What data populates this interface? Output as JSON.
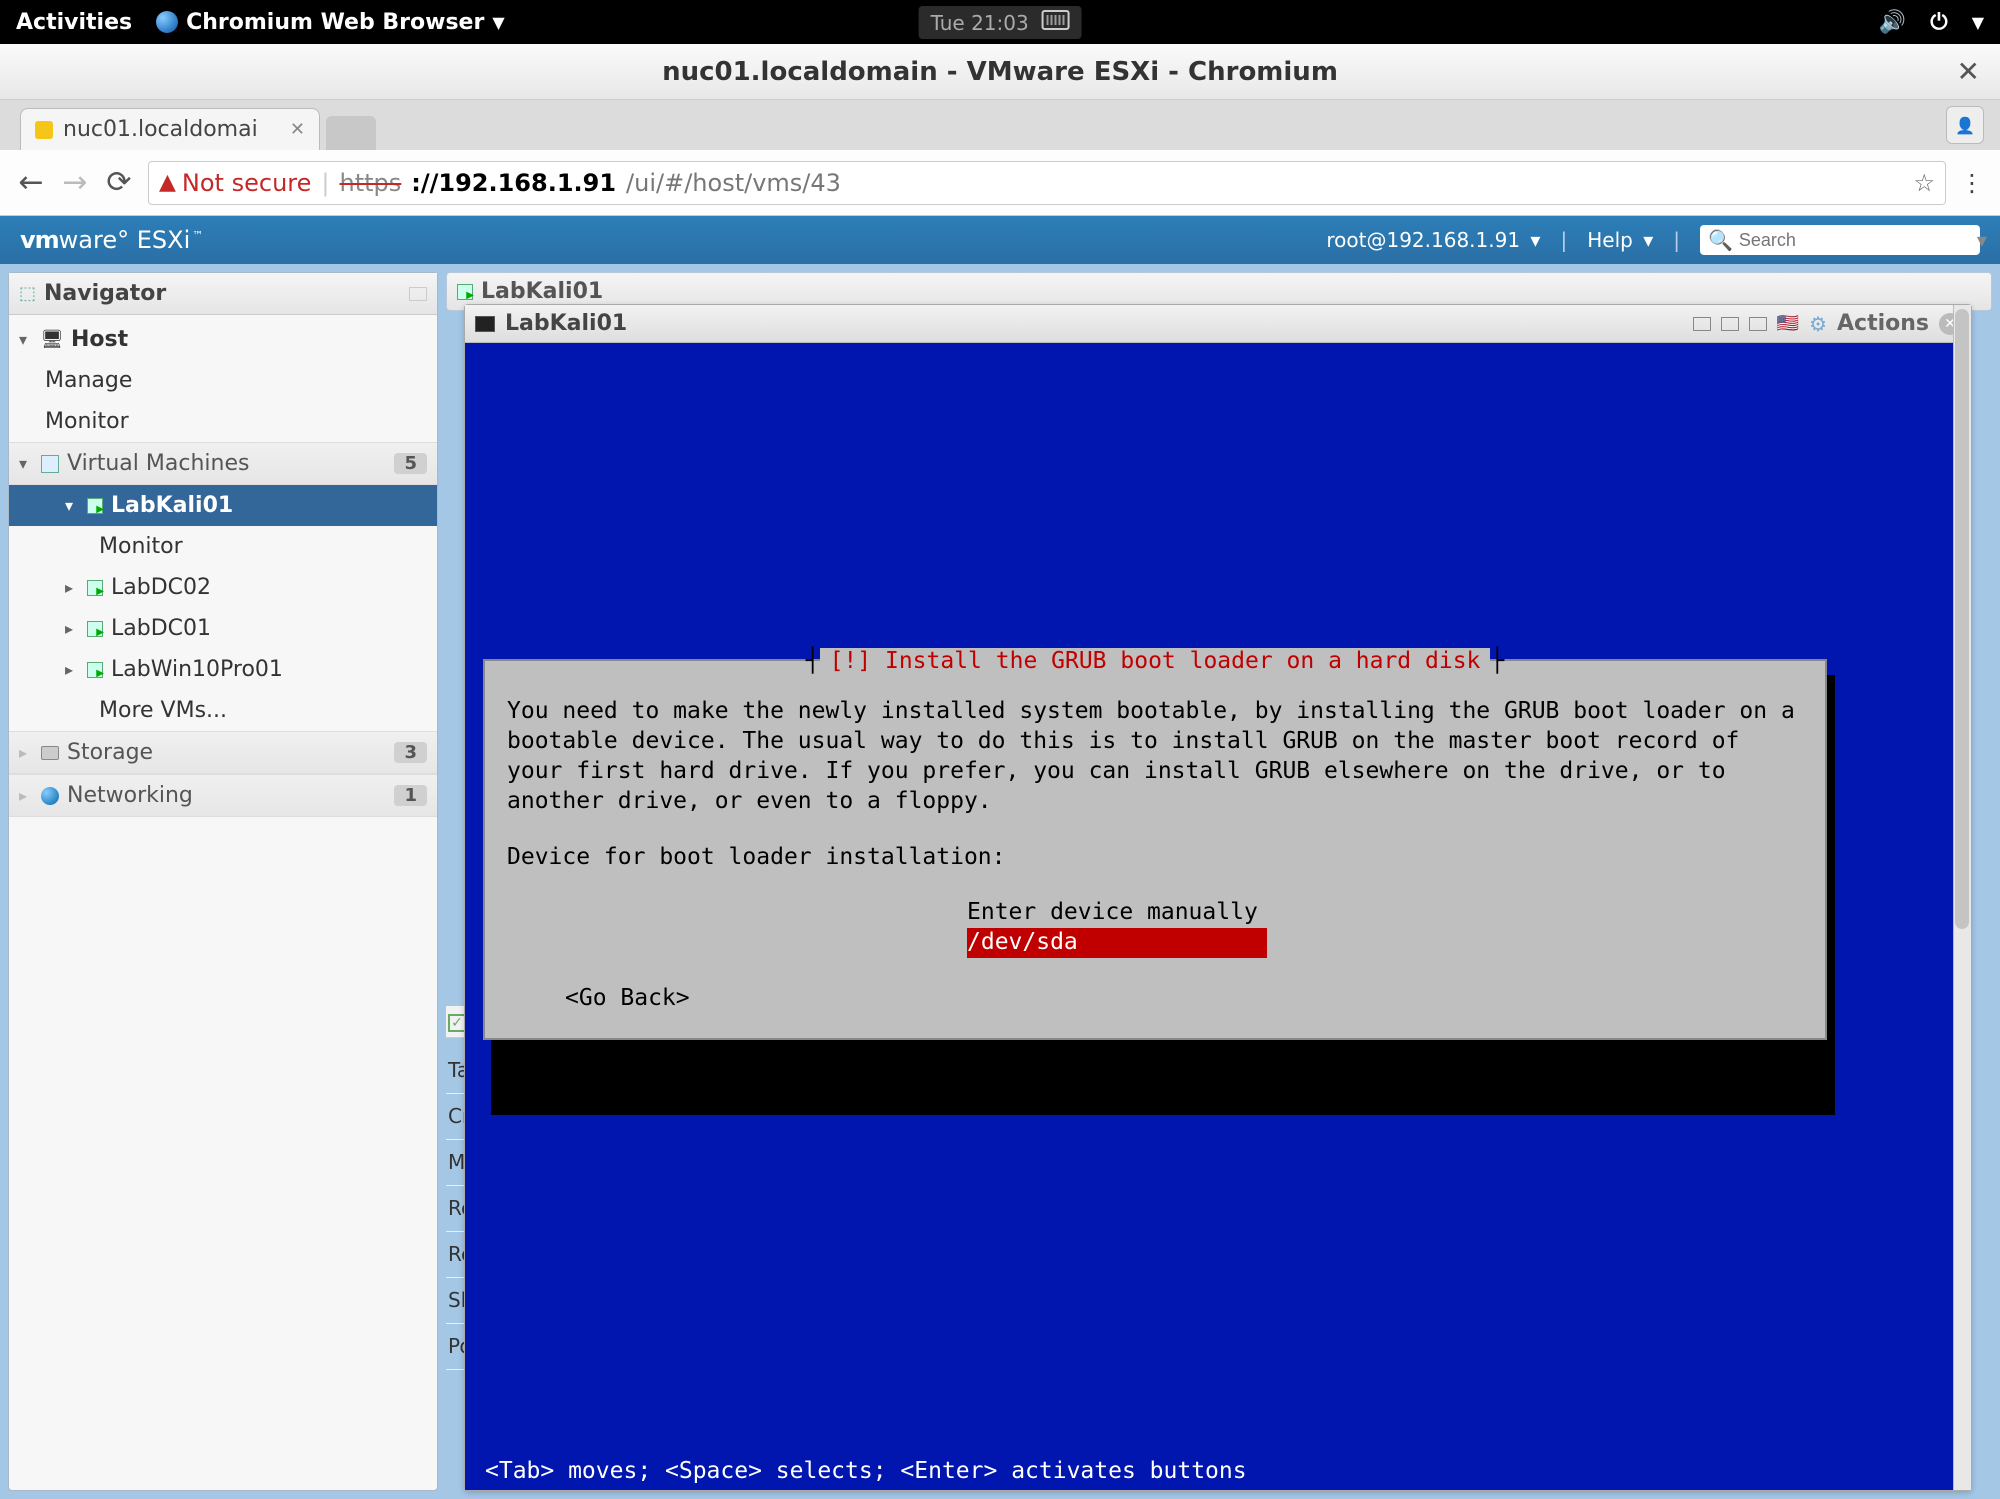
{
  "gnome": {
    "activities": "Activities",
    "app_name": "Chromium Web Browser",
    "clock": "Tue 21:03"
  },
  "window": {
    "title": "nuc01.localdomain - VMware ESXi - Chromium"
  },
  "tab": {
    "title": "nuc01.localdomai"
  },
  "addressbar": {
    "not_secure": "Not secure",
    "scheme": "https",
    "host": "://192.168.1.91",
    "path": "/ui/#/host/vms/43"
  },
  "vmheader": {
    "logo_a": "vm",
    "logo_b": "ware",
    "logo_c": " ESXi",
    "user": "root@192.168.1.91",
    "help": "Help",
    "search_placeholder": "Search"
  },
  "navigator": {
    "title": "Navigator",
    "host": "Host",
    "manage": "Manage",
    "monitor": "Monitor",
    "vms": "Virtual Machines",
    "vms_count": "5",
    "items": [
      {
        "label": "LabKali01"
      },
      {
        "label": "Monitor"
      },
      {
        "label": "LabDC02"
      },
      {
        "label": "LabDC01"
      },
      {
        "label": "LabWin10Pro01"
      },
      {
        "label": "More VMs..."
      }
    ],
    "storage": "Storage",
    "storage_count": "3",
    "networking": "Networking",
    "networking_count": "1"
  },
  "breadcrumb": {
    "name": "LabKali01"
  },
  "console": {
    "title": "LabKali01",
    "actions": "Actions"
  },
  "installer": {
    "title": "[!] Install the GRUB boot loader on a hard disk",
    "body": "You need to make the newly installed system bootable, by installing the GRUB boot loader on a bootable device. The usual way to do this is to install GRUB on the master boot record of your first hard drive. If you prefer, you can install GRUB elsewhere on the drive, or to another drive, or even to a floppy.",
    "prompt": "Device for boot loader installation:",
    "opt_manual": "Enter device manually",
    "opt_dev": "/dev/sda",
    "go_back": "<Go Back>",
    "footer": "<Tab> moves; <Space> selects; <Enter> activates buttons"
  },
  "under_rows": [
    "Ta",
    "Cr",
    "M",
    "Re",
    "Re",
    "Sh",
    "Po"
  ]
}
